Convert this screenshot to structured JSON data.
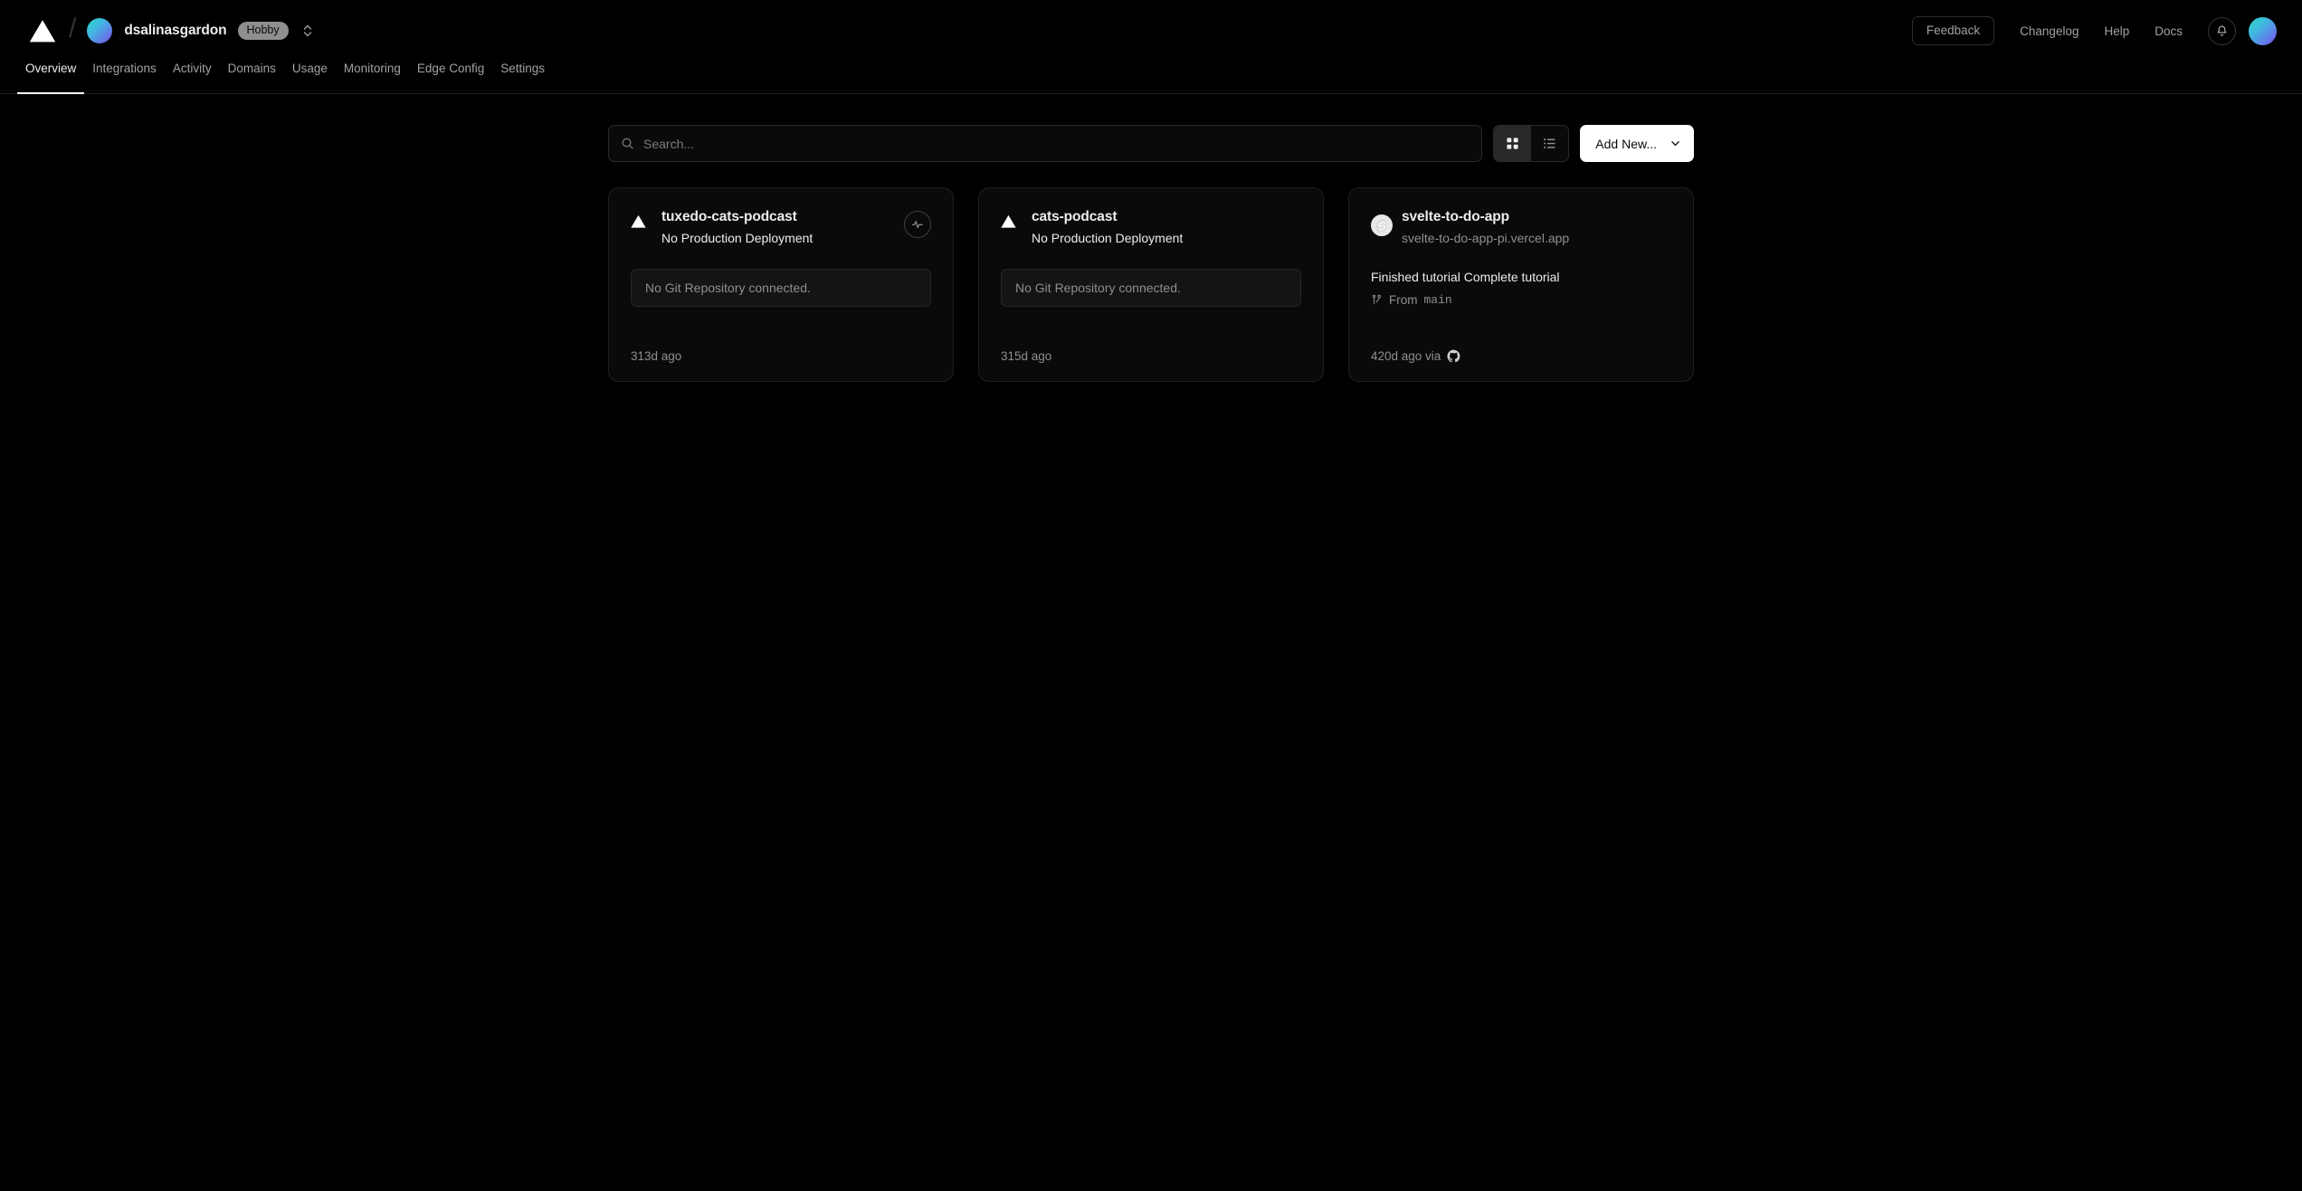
{
  "topbar": {
    "logo_icon": "vercel-triangle-logo",
    "separator": "/",
    "team_avatar_icon": "team-avatar-gradient",
    "team_name": "dsalinasgardon",
    "plan_badge": "Hobby",
    "scope_switcher_icon": "chevron-up-down-icon",
    "feedback_label": "Feedback",
    "links": [
      {
        "label": "Changelog"
      },
      {
        "label": "Help"
      },
      {
        "label": "Docs"
      }
    ],
    "notifications_icon": "bell-icon",
    "user_avatar_icon": "user-avatar-gradient"
  },
  "tabs": [
    {
      "label": "Overview",
      "active": true
    },
    {
      "label": "Integrations",
      "active": false
    },
    {
      "label": "Activity",
      "active": false
    },
    {
      "label": "Domains",
      "active": false
    },
    {
      "label": "Usage",
      "active": false
    },
    {
      "label": "Monitoring",
      "active": false
    },
    {
      "label": "Edge Config",
      "active": false
    },
    {
      "label": "Settings",
      "active": false
    }
  ],
  "toolbar": {
    "search_icon": "search-icon",
    "search_value": "",
    "search_placeholder": "Search...",
    "grid_view_icon": "grid-view-icon",
    "list_view_icon": "list-view-icon",
    "grid_view_active": true,
    "add_new_label": "Add New...",
    "add_new_chevron_icon": "chevron-down-icon"
  },
  "projects": [
    {
      "icon": "vercel-triangle-logo",
      "title": "tuxedo-cats-podcast",
      "subtitle": "No Production Deployment",
      "subtitle_muted": false,
      "has_activity_button": true,
      "activity_icon": "activity-pulse-icon",
      "no_repo_text": "No Git Repository connected.",
      "timestamp": "313d ago"
    },
    {
      "icon": "vercel-triangle-logo",
      "title": "cats-podcast",
      "subtitle": "No Production Deployment",
      "subtitle_muted": false,
      "has_activity_button": false,
      "no_repo_text": "No Git Repository connected.",
      "timestamp": "315d ago"
    },
    {
      "icon": "svelte-logo",
      "title": "svelte-to-do-app",
      "subtitle": "svelte-to-do-app-pi.vercel.app",
      "subtitle_muted": true,
      "has_activity_button": false,
      "commit_message": "Finished tutorial Complete tutorial",
      "branch_icon": "git-branch-icon",
      "branch_prefix": "From",
      "branch_name": "main",
      "timestamp": "420d ago via",
      "source_icon": "github-icon"
    }
  ],
  "colors": {
    "background": "#000000",
    "card_background": "#0a0a0a",
    "card_border": "#1f1f1f",
    "text_primary": "#ededed",
    "text_muted": "#8f8f8f",
    "accent_white": "#ffffff"
  }
}
